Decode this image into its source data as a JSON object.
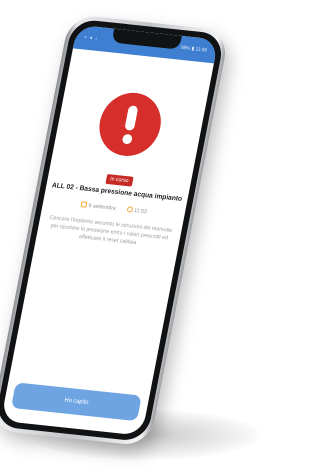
{
  "status_bar": {
    "left_icons": "▪ ◂ ↓",
    "right_text": "98% ▮ 11:48"
  },
  "alert": {
    "icon": "exclamation-icon",
    "badge_label": "In corso",
    "title": "ALL 02 - Bassa pressione acqua impianto",
    "date": "9 settembre",
    "time": "11:53",
    "description_lines": [
      "Caricare l'impianto secondo le istruzioni del manuale",
      "per riportare la pressione entro i valori prescritti ed",
      "effettuare il reset caldaia"
    ]
  },
  "actions": {
    "ack_label": "Ho capito"
  },
  "colors": {
    "status_bar": "#3f7fd1",
    "alert_red": "#d62e2a",
    "badge_red": "#c62a24",
    "button_blue": "#6fa4e3",
    "icon_orange": "#f0a830"
  }
}
